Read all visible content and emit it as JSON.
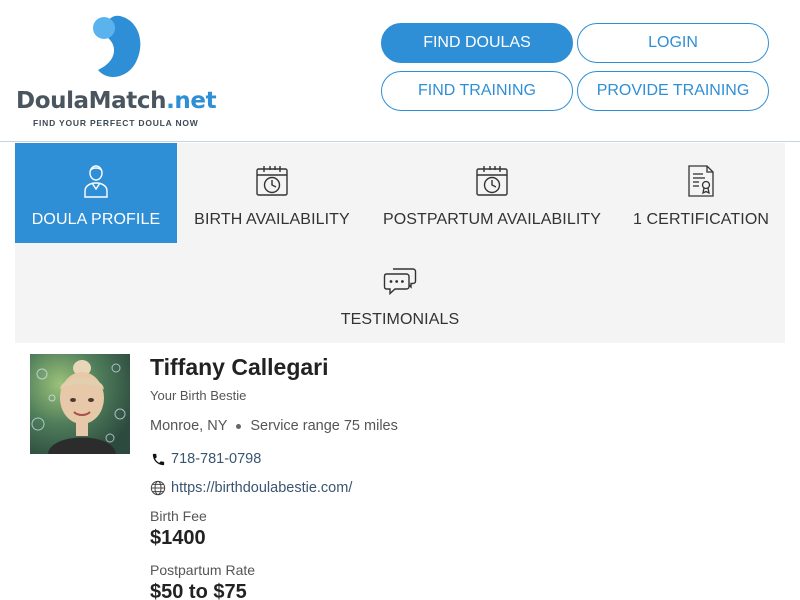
{
  "brand": {
    "name_main": "DoulaMatch",
    "name_suffix": ".net",
    "tagline": "FIND YOUR PERFECT DOULA NOW",
    "primary_color": "#2f8fd6",
    "light_color": "#5bb3ee"
  },
  "nav": {
    "find_doulas": "FIND DOULAS",
    "login": "LOGIN",
    "find_training": "FIND TRAINING",
    "provide_training": "PROVIDE TRAINING"
  },
  "tabs": [
    {
      "label": "DOULA PROFILE",
      "icon": "doula-person-icon",
      "active": true
    },
    {
      "label": "BIRTH AVAILABILITY",
      "icon": "calendar-clock-icon",
      "active": false
    },
    {
      "label": "POSTPARTUM AVAILABILITY",
      "icon": "calendar-clock-icon",
      "active": false
    },
    {
      "label": "1 CERTIFICATION",
      "icon": "certificate-icon",
      "active": false
    },
    {
      "label": "TESTIMONIALS",
      "icon": "chat-bubbles-icon",
      "active": false
    }
  ],
  "profile": {
    "name": "Tiffany Callegari",
    "tagline": "Your Birth Bestie",
    "location": "Monroe, NY",
    "service_range": "Service range 75 miles",
    "phone": "718-781-0798",
    "website": "https://birthdoulabestie.com/",
    "birth_fee_label": "Birth Fee",
    "birth_fee": "$1400",
    "postpartum_label": "Postpartum Rate",
    "postpartum_rate": "$50 to $75"
  }
}
